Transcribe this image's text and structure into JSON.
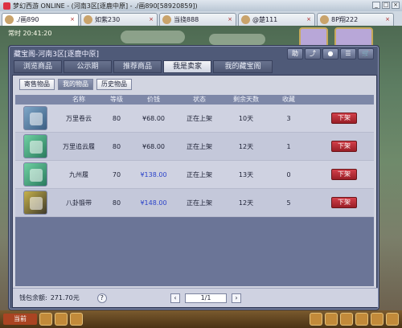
{
  "window": {
    "title": "梦幻西游 ONLINE - (河南3区[逐鹿中原] - ./画890[58920859])",
    "controls": [
      "_",
      "□",
      "×"
    ]
  },
  "tabs": [
    {
      "label": "./画890",
      "active": true
    },
    {
      "label": "如紫230",
      "active": false
    },
    {
      "label": "当挠888",
      "active": false
    },
    {
      "label": "@楚111",
      "active": false
    },
    {
      "label": "8P翔222",
      "active": false
    }
  ],
  "scene": {
    "hud_time": "常时  20:41:20"
  },
  "dialog": {
    "title": "藏宝阁-河南3区[逐鹿中原]",
    "header_icons": [
      "助",
      "⤴",
      "●",
      "☰",
      "🛒"
    ],
    "main_tabs": [
      "浏览商品",
      "公示期",
      "推荐商品",
      "我是卖家",
      "我的藏宝阁"
    ],
    "active_main_tab": 3,
    "sub_tabs": [
      "寄售物品",
      "我的物品",
      "历史物品"
    ],
    "active_sub_tab": 1,
    "columns": [
      "名称",
      "等级",
      "价钱",
      "状态",
      "剩余天数",
      "收藏"
    ],
    "items": [
      {
        "icon": "sword-item-icon",
        "name": "万里卷云",
        "level": "80",
        "price": "¥68.00",
        "price_highlight": false,
        "status": "正在上架",
        "days": "10天",
        "fav": "3",
        "action": "下架"
      },
      {
        "icon": "boot-item-icon",
        "name": "万里追云履",
        "level": "80",
        "price": "¥68.00",
        "price_highlight": false,
        "status": "正在上架",
        "days": "12天",
        "fav": "1",
        "action": "下架"
      },
      {
        "icon": "boot-item-icon",
        "name": "九州履",
        "level": "70",
        "price": "¥138.00",
        "price_highlight": true,
        "status": "正在上架",
        "days": "13天",
        "fav": "0",
        "action": "下架"
      },
      {
        "icon": "belt-item-icon",
        "name": "八卦锻带",
        "level": "80",
        "price": "¥148.00",
        "price_highlight": true,
        "status": "正在上架",
        "days": "12天",
        "fav": "5",
        "action": "下架"
      }
    ],
    "balance_label": "钱包余额:",
    "balance_value": "271.70元",
    "help": "?",
    "pager": {
      "prev": "‹",
      "page_text": "1/1",
      "next": "›"
    }
  },
  "bottombar": {
    "chat": "当前"
  }
}
